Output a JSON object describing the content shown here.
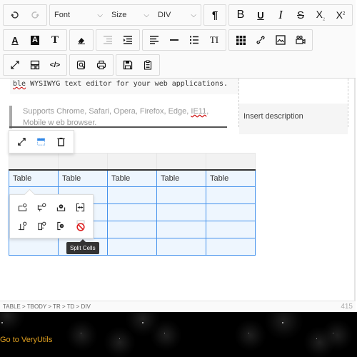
{
  "toolbar": {
    "row1": {
      "undo": "undo-icon",
      "redo": "redo-icon",
      "font_select": "Font",
      "size_select": "Size",
      "format_select": "DIV",
      "paragraph": "¶",
      "bold": "B",
      "underline": "U",
      "italic": "I",
      "strike": "S",
      "subscript": "X",
      "superscript": "X"
    },
    "row2": {
      "font_color": "A",
      "highlight": "A",
      "text_style": "T",
      "line_height": "TI"
    },
    "row3": {}
  },
  "content": {
    "code_text_prefix": "ble",
    "code_text": " WYSIWYG text editor for your web applications.",
    "quote_text_a": "Supports Chrome, Safari, Opera, Firefox, Edge, ",
    "quote_text_spell": "IE11",
    "quote_text_b": ", Mobile w eb browser.",
    "image_caption": "Insert description"
  },
  "table": {
    "header_cells": [
      "",
      "",
      "",
      "",
      ""
    ],
    "rows": [
      [
        "Table",
        "Table",
        "Table",
        "Table",
        "Table"
      ],
      [
        "",
        "",
        "",
        "",
        ""
      ],
      [
        "",
        "",
        "",
        "",
        ""
      ],
      [
        "",
        "",
        "",
        "",
        ""
      ],
      [
        "",
        "",
        "",
        "",
        ""
      ]
    ]
  },
  "cell_controller": {
    "tooltip": "Split Cells"
  },
  "statusbar": {
    "path": "TABLE > TBODY > TR > TD > DIV",
    "char_count": "415"
  },
  "footer": {
    "link": "Go to VeryUtils"
  },
  "colors": {
    "table_border": "#4592ec",
    "table_cell_bg": "#eef6fe",
    "footer_link": "#e0a020",
    "tooltip_bg": "#333333"
  }
}
